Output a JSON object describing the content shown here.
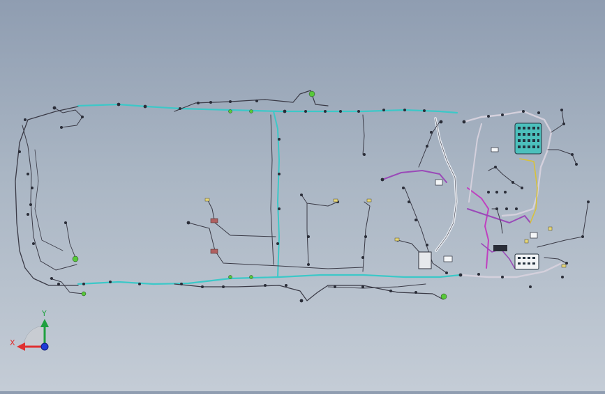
{
  "triad": {
    "x_label": "X",
    "y_label": "Y",
    "x_color": "#e03030",
    "y_color": "#20a040",
    "z_color": "#1e3cd8"
  },
  "harness_colors": {
    "main_trunk": "#3cc8c8",
    "branch_dark": "#3a3a46",
    "engine_purple": "#9a4ab8",
    "magenta": "#c040c0",
    "connector_green": "#58c83a",
    "fuse_box": "#4cc0bc",
    "clip_red": "#b06060",
    "yellow": "#d8c23a"
  }
}
